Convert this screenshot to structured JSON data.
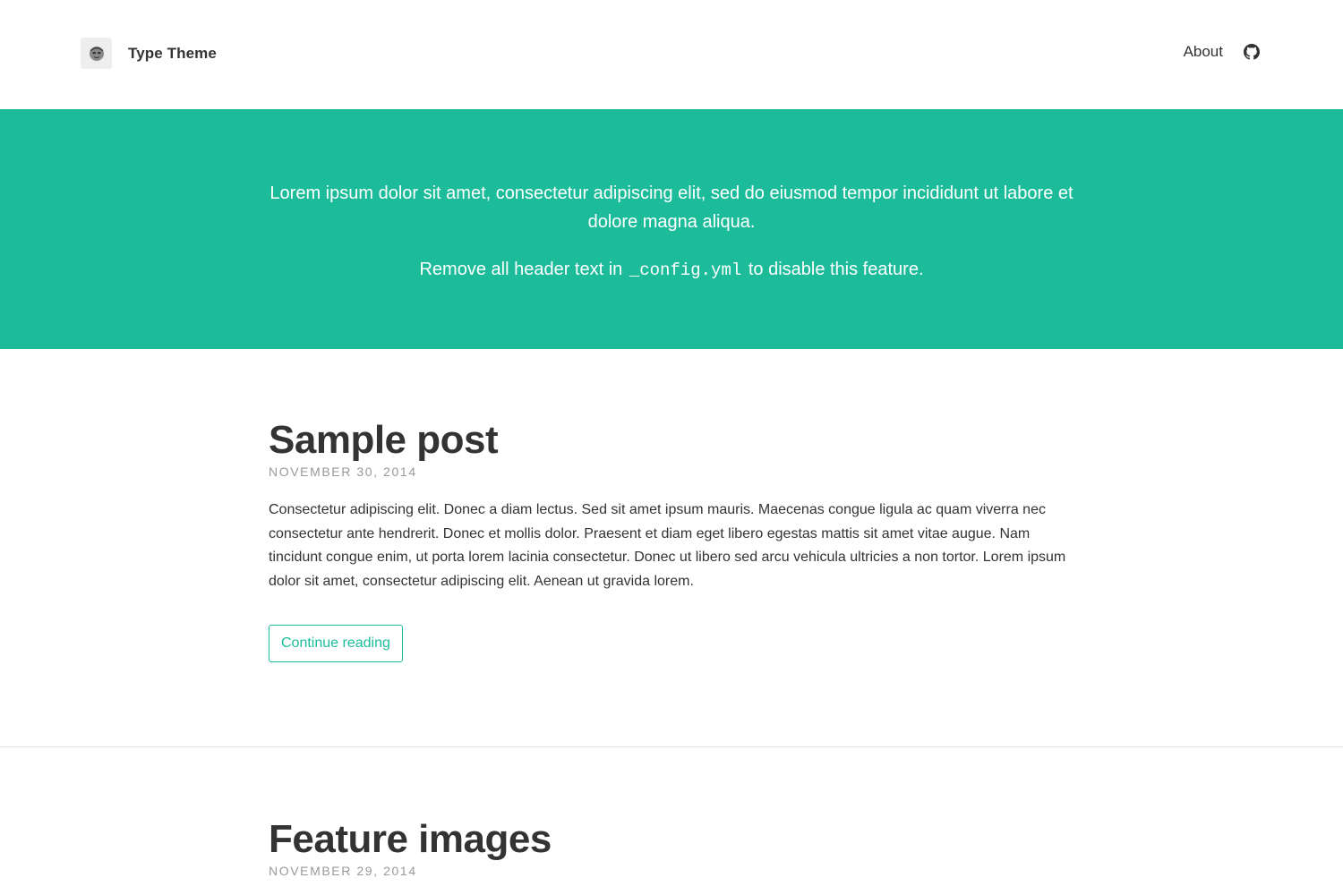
{
  "site": {
    "title": "Type Theme",
    "avatar_icon": "avatar-face-icon",
    "accent_color": "#1cbc9b"
  },
  "nav": {
    "about_label": "About",
    "github_icon": "github-icon"
  },
  "hero": {
    "line1": "Lorem ipsum dolor sit amet, consectetur adipiscing elit, sed do eiusmod tempor incididunt ut labore et dolore magna aliqua.",
    "line2_before": "Remove all header text in",
    "line2_code": "_config.yml",
    "line2_after": "to disable this feature."
  },
  "posts": [
    {
      "title": "Sample post",
      "date": "NOVEMBER 30, 2014",
      "excerpt": "Consectetur adipiscing elit. Donec a diam lectus. Sed sit amet ipsum mauris. Maecenas congue ligula ac quam viverra nec consectetur ante hendrerit. Donec et mollis dolor. Praesent et diam eget libero egestas mattis sit amet vitae augue. Nam tincidunt congue enim, ut porta lorem lacinia consectetur. Donec ut libero sed arcu vehicula ultricies a non tortor. Lorem ipsum dolor sit amet, consectetur adipiscing elit. Aenean ut gravida lorem.",
      "button_label": "Continue reading"
    },
    {
      "title": "Feature images",
      "date": "NOVEMBER 29, 2014"
    }
  ]
}
